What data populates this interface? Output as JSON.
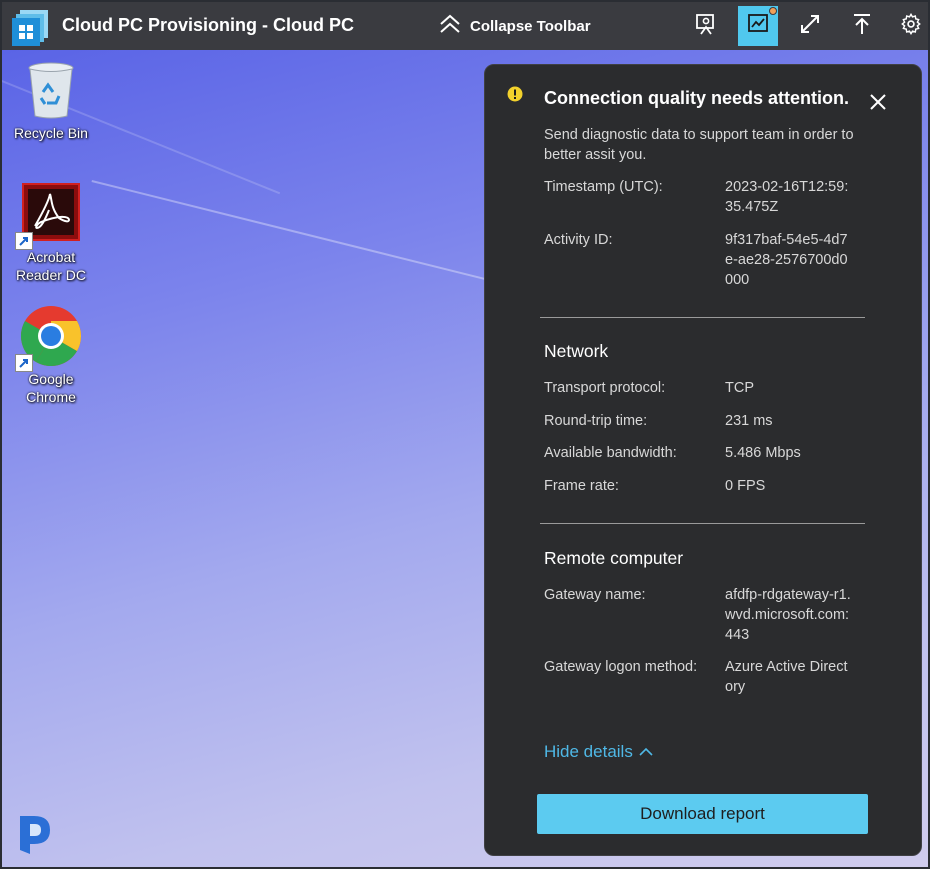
{
  "window": {
    "title": "Cloud PC Provisioning - Cloud PC",
    "collapse_label": "Collapse Toolbar",
    "toolbar_icons": [
      "connection-info-icon",
      "connection-quality-icon",
      "fullscreen-icon",
      "pin-top-icon",
      "gear-icon"
    ],
    "accent": "#50c8ee",
    "notify_dot": "#f0a05a"
  },
  "desktop": {
    "icons": [
      {
        "label": "Recycle Bin",
        "icon": "recycle-bin-icon"
      },
      {
        "label": "Acrobat Reader DC",
        "icon": "acrobat-icon"
      },
      {
        "label": "Google Chrome",
        "icon": "chrome-icon"
      }
    ],
    "brand_icon": "brand-logo-icon"
  },
  "panel": {
    "title": "Connection quality needs attention.",
    "description": "Send diagnostic data to support team in order to better assit you.",
    "timestamp_label": "Timestamp (UTC):",
    "timestamp_value": "2023-02-16T12:59:35.475Z",
    "activity_label": "Activity ID:",
    "activity_value": "9f317baf-54e5-4d7e-ae28-2576700d0000",
    "network": {
      "heading": "Network",
      "rows": [
        {
          "label": "Transport protocol:",
          "value": "TCP"
        },
        {
          "label": "Round-trip time:",
          "value": "231 ms"
        },
        {
          "label": "Available bandwidth:",
          "value": "5.486 Mbps"
        },
        {
          "label": "Frame rate:",
          "value": "0 FPS"
        }
      ]
    },
    "remote": {
      "heading": "Remote computer",
      "rows": [
        {
          "label": "Gateway name:",
          "value": "afdfp-rdgateway-r1.wvd.microsoft.com:443"
        },
        {
          "label": "Gateway logon method:",
          "value": "Azure Active Directory"
        }
      ]
    },
    "hide_details": "Hide details",
    "download_label": "Download report",
    "link_color": "#4fb8e6",
    "warning_color": "#f3d22c"
  }
}
